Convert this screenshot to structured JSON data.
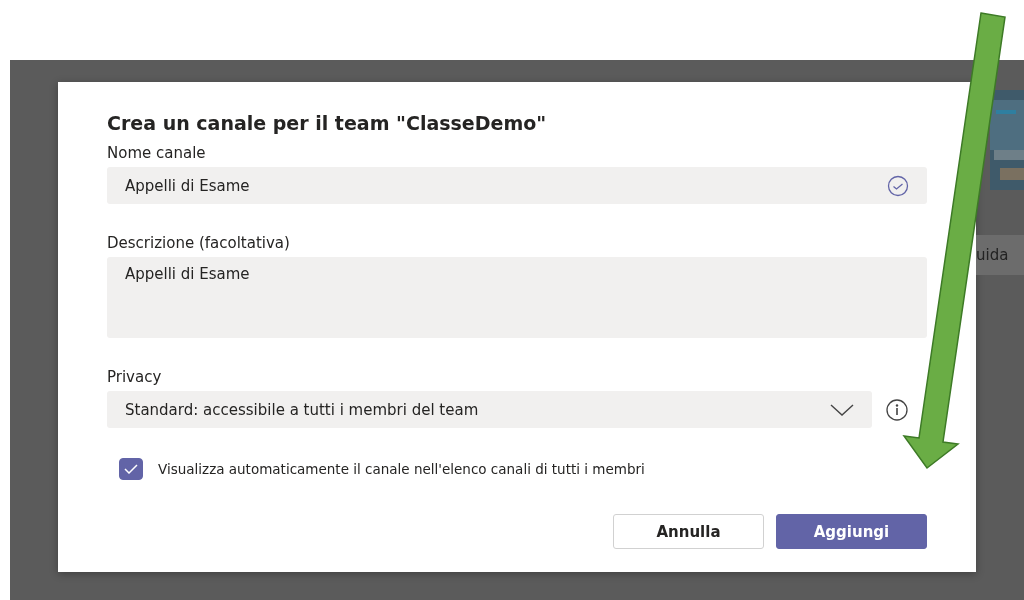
{
  "dialog": {
    "title": "Crea un canale per il team \"ClasseDemo\"",
    "fields": [
      {
        "kind": "input",
        "label": "Nome canale",
        "value": "Appelli di Esame",
        "valid": true
      },
      {
        "kind": "textarea",
        "label": "Descrizione (facoltativa)",
        "value": "Appelli di Esame"
      },
      {
        "kind": "select",
        "label": "Privacy",
        "value": "Standard: accessibile a tutti i membri del team"
      }
    ],
    "checkbox": {
      "label": "Visualizza automaticamente il canale nell'elenco canali di tutti i membri",
      "checked": true
    },
    "buttons": [
      {
        "label": "Annulla",
        "primary": false
      },
      {
        "label": "Aggiungi",
        "primary": true
      }
    ]
  },
  "background": {
    "button_text": "uida"
  }
}
